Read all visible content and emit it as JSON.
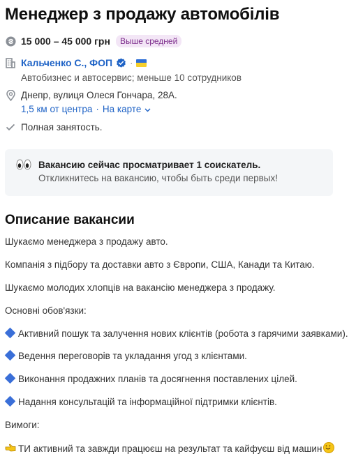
{
  "job": {
    "title": "Менеджер з продажу автомобілів",
    "salary": "15 000 – 45 000 грн",
    "salary_badge": "Выше средней",
    "company": {
      "name": "Кальченко С., ФОП",
      "separator": "·",
      "description": "Автобизнес и автосервис; меньше 10 сотрудников"
    },
    "address": "Днепр, вулиця Олеся Гончара, 28А.",
    "distance": "1,5 км от центра",
    "link_separator": "·",
    "map_link": "На карте",
    "employment": "Полная занятость."
  },
  "notice": {
    "title": "Вакансию сейчас просматривает 1 соискатель.",
    "subtitle": "Откликнитесь на вакансию, чтобы быть среди первых!"
  },
  "description": {
    "heading": "Описание вакансии",
    "lines": [
      "Шукаємо менеджера з продажу авто.",
      "Компанія з підбору та доставки авто з Європи, США, Канади та Китаю.",
      "Шукаємо молодих хлопців на вакансію менеджера з продажу.",
      "Основні обов'язки:",
      "Активний пошук та залучення нових клієнтів (робота з гарячими заявками).",
      "Ведення переговорів та укладання угод з клієнтами.",
      "Виконання продажних планів та досягнення поставлених цілей.",
      "Надання консультацій та інформаційної підтримки клієнтів.",
      "Вимоги:",
      "ТИ активний та завжди працюєш на результат та кайфуєш від машин"
    ]
  },
  "icons": {
    "salary": "hryvnia-coin-icon",
    "company": "building-icon",
    "verified": "verified-check-icon",
    "flag": "ukraine-flag-icon",
    "location": "map-pin-icon",
    "employment": "checkmark-icon",
    "eyes": "eyes-icon",
    "bullet": "blue-diamond-icon",
    "hand": "pointing-hand-icon",
    "smile": "smiling-face-icon"
  },
  "colors": {
    "link": "#1f63c6",
    "badge_bg": "#f3e6f6",
    "badge_text": "#7b2b8a",
    "notice_bg": "#f4f6f8",
    "bullet": "#3a6fd8"
  }
}
